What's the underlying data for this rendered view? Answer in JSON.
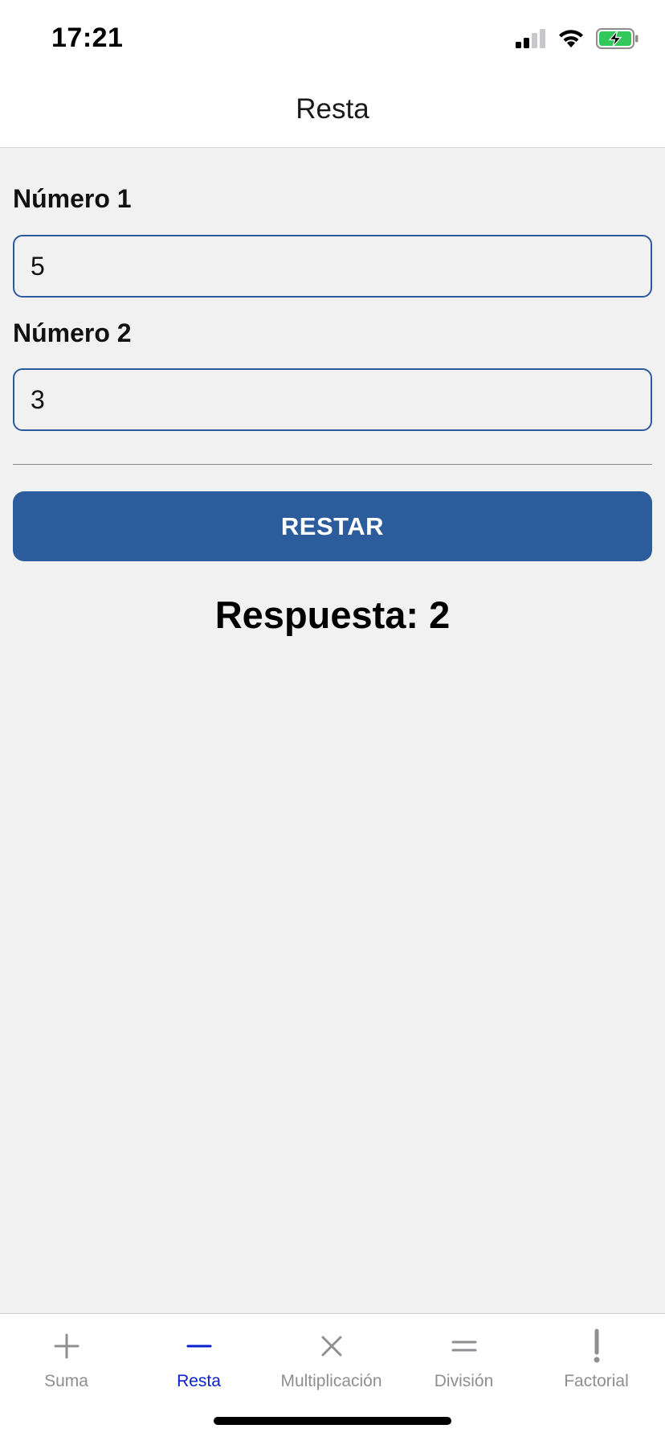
{
  "status_bar": {
    "time": "17:21",
    "icons": [
      "cellular-signal-icon",
      "wifi-icon",
      "battery-charging-icon"
    ]
  },
  "nav": {
    "title": "Resta"
  },
  "form": {
    "field1": {
      "label": "Número 1",
      "value": "5"
    },
    "field2": {
      "label": "Número 2",
      "value": "3"
    },
    "button_label": "RESTAR",
    "answer_text": "Respuesta: 2"
  },
  "tabs": [
    {
      "label": "Suma",
      "icon": "plus-icon",
      "active": false
    },
    {
      "label": "Resta",
      "icon": "minus-icon",
      "active": true
    },
    {
      "label": "Multiplicación",
      "icon": "times-icon",
      "active": false
    },
    {
      "label": "División",
      "icon": "equals-icon",
      "active": false
    },
    {
      "label": "Factorial",
      "icon": "exclamation-icon",
      "active": false
    }
  ],
  "colors": {
    "accent": "#2c5c9c",
    "active_tab": "#0a1fd0",
    "inactive_tab": "#8e8e93",
    "background": "#f1f1f2",
    "battery": "#34c759"
  }
}
